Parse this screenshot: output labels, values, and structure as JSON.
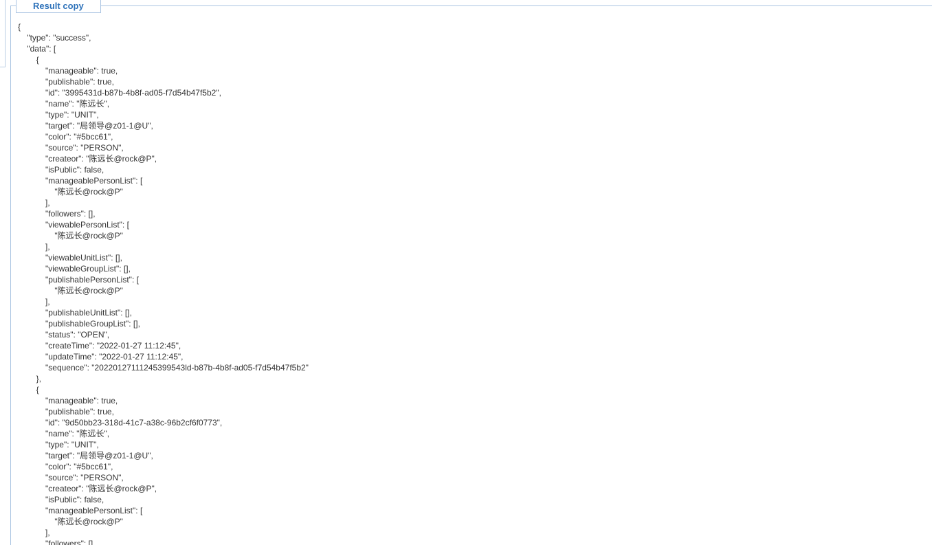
{
  "panel": {
    "title": "Result copy"
  },
  "json_lines": [
    "{",
    "    \"type\": \"success\",",
    "    \"data\": [",
    "        {",
    "            \"manageable\": true,",
    "            \"publishable\": true,",
    "            \"id\": \"3995431d-b87b-4b8f-ad05-f7d54b47f5b2\",",
    "            \"name\": \"陈远长\",",
    "            \"type\": \"UNIT\",",
    "            \"target\": \"局领导@z01-1@U\",",
    "            \"color\": \"#5bcc61\",",
    "            \"source\": \"PERSON\",",
    "            \"createor\": \"陈远长@rock@P\",",
    "            \"isPublic\": false,",
    "            \"manageablePersonList\": [",
    "                \"陈远长@rock@P\"",
    "            ],",
    "            \"followers\": [],",
    "            \"viewablePersonList\": [",
    "                \"陈远长@rock@P\"",
    "            ],",
    "            \"viewableUnitList\": [],",
    "            \"viewableGroupList\": [],",
    "            \"publishablePersonList\": [",
    "                \"陈远长@rock@P\"",
    "            ],",
    "            \"publishableUnitList\": [],",
    "            \"publishableGroupList\": [],",
    "            \"status\": \"OPEN\",",
    "            \"createTime\": \"2022-01-27 11:12:45\",",
    "            \"updateTime\": \"2022-01-27 11:12:45\",",
    "            \"sequence\": \"20220127111245399543ld-b87b-4b8f-ad05-f7d54b47f5b2\"",
    "        },",
    "        {",
    "            \"manageable\": true,",
    "            \"publishable\": true,",
    "            \"id\": \"9d50bb23-318d-41c7-a38c-96b2cf6f0773\",",
    "            \"name\": \"陈远长\",",
    "            \"type\": \"UNIT\",",
    "            \"target\": \"局领导@z01-1@U\",",
    "            \"color\": \"#5bcc61\",",
    "            \"source\": \"PERSON\",",
    "            \"createor\": \"陈远长@rock@P\",",
    "            \"isPublic\": false,",
    "            \"manageablePersonList\": [",
    "                \"陈远长@rock@P\"",
    "            ],",
    "            \"followers\": [],"
  ],
  "colors": {
    "border": "#a9c4e2",
    "title": "#2f73ba",
    "text": "#333333"
  }
}
